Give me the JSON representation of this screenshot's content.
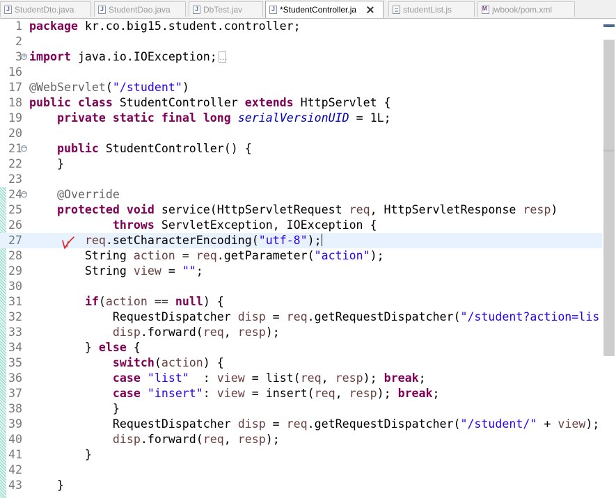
{
  "tabs": [
    {
      "label": "StudentDto.java",
      "icon": "java-file-icon",
      "active": false
    },
    {
      "label": "StudentDao.java",
      "icon": "java-file-icon",
      "active": false
    },
    {
      "label": "DbTest.jav",
      "icon": "java-file-icon",
      "active": false
    },
    {
      "label": "*StudentController.ja",
      "icon": "java-file-icon",
      "active": true
    },
    {
      "label": "studentList.js",
      "icon": "page-file-icon",
      "active": false
    },
    {
      "label": "jwbook/pom.xml",
      "icon": "maven-file-icon",
      "active": false
    }
  ],
  "editor": {
    "current_line": "27",
    "annotation_mark_color": "#e02020",
    "lines": [
      {
        "num": "1",
        "text": "package kr.co.big15.student.controller;"
      },
      {
        "num": "2",
        "text": ""
      },
      {
        "num": "3",
        "text": "import java.io.IOException;"
      },
      {
        "num": "16",
        "text": ""
      },
      {
        "num": "17",
        "text": "@WebServlet(\"/student\")"
      },
      {
        "num": "18",
        "text": "public class StudentController extends HttpServlet {"
      },
      {
        "num": "19",
        "text": "    private static final long serialVersionUID = 1L;"
      },
      {
        "num": "20",
        "text": ""
      },
      {
        "num": "21",
        "text": "    public StudentController() {"
      },
      {
        "num": "22",
        "text": "    }"
      },
      {
        "num": "23",
        "text": ""
      },
      {
        "num": "24",
        "text": "    @Override"
      },
      {
        "num": "25",
        "text": "    protected void service(HttpServletRequest req, HttpServletResponse resp)"
      },
      {
        "num": "26",
        "text": "            throws ServletException, IOException {"
      },
      {
        "num": "27",
        "text": "        req.setCharacterEncoding(\"utf-8\");"
      },
      {
        "num": "28",
        "text": "        String action = req.getParameter(\"action\");"
      },
      {
        "num": "29",
        "text": "        String view = \"\";"
      },
      {
        "num": "30",
        "text": ""
      },
      {
        "num": "31",
        "text": "        if(action == null) {"
      },
      {
        "num": "32",
        "text": "            RequestDispatcher disp = req.getRequestDispatcher(\"/student?action=lis"
      },
      {
        "num": "33",
        "text": "            disp.forward(req, resp);"
      },
      {
        "num": "34",
        "text": "        } else {"
      },
      {
        "num": "35",
        "text": "            switch(action) {"
      },
      {
        "num": "36",
        "text": "            case \"list\"  : view = list(req, resp); break;"
      },
      {
        "num": "37",
        "text": "            case \"insert\": view = insert(req, resp); break;"
      },
      {
        "num": "38",
        "text": "            }"
      },
      {
        "num": "39",
        "text": "            RequestDispatcher disp = req.getRequestDispatcher(\"/student/\" + view);"
      },
      {
        "num": "40",
        "text": "            disp.forward(req, resp);"
      },
      {
        "num": "41",
        "text": "        }"
      },
      {
        "num": "42",
        "text": ""
      },
      {
        "num": "43",
        "text": "    }"
      }
    ]
  }
}
